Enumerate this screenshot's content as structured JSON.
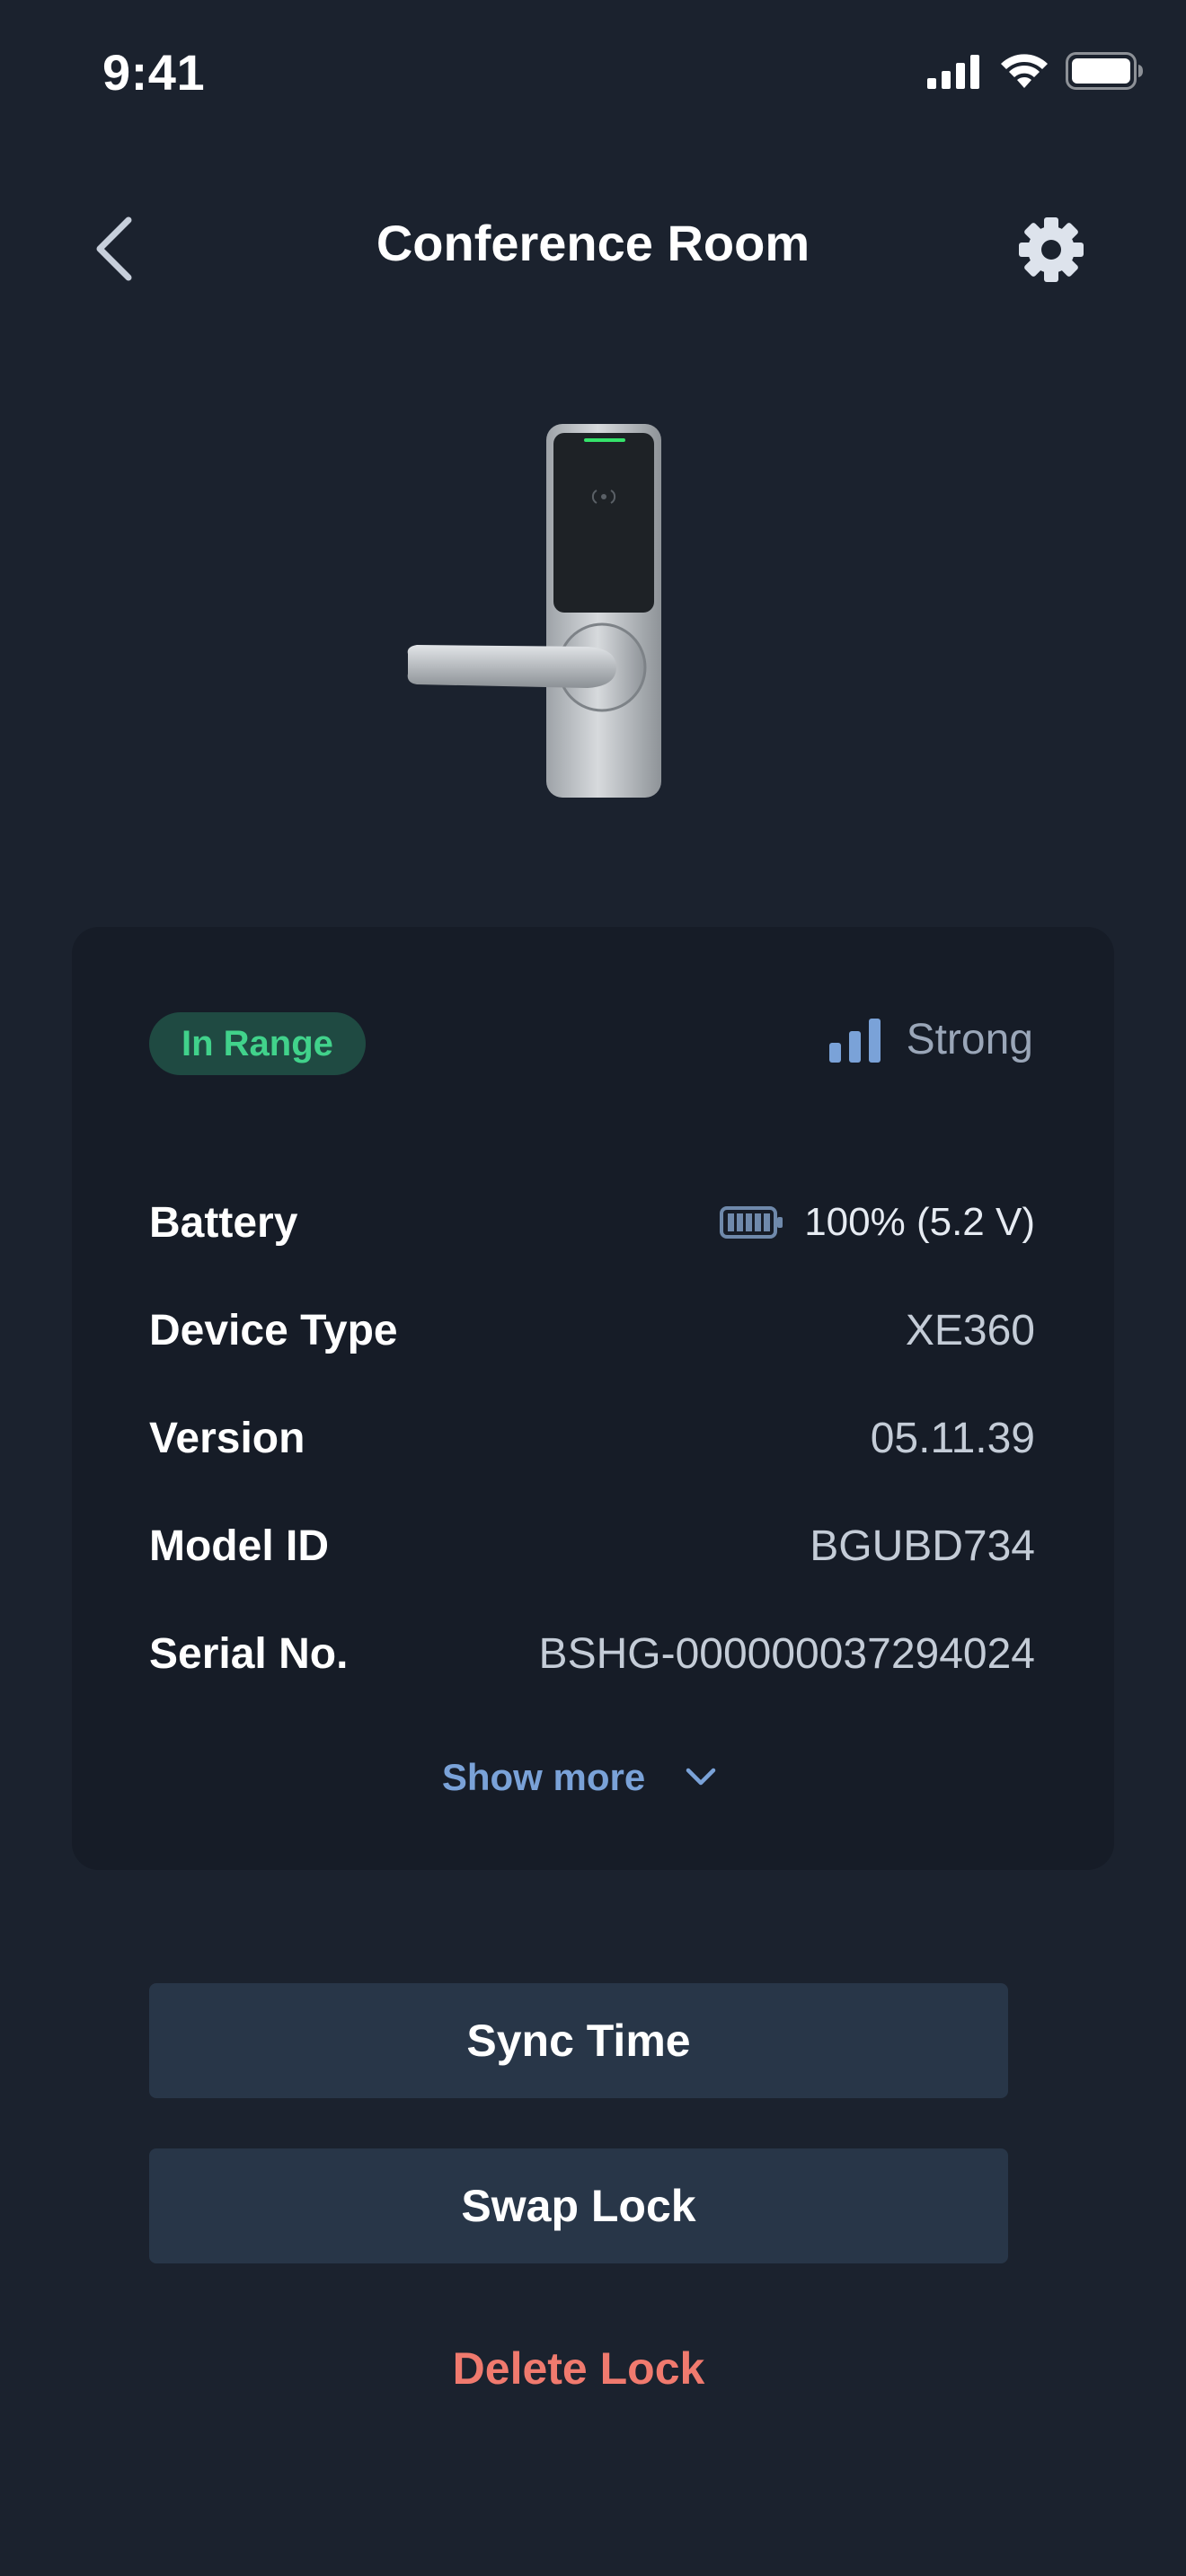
{
  "status_bar": {
    "time": "9:41"
  },
  "header": {
    "title": "Conference Room"
  },
  "card": {
    "range_badge": "In Range",
    "signal_label": "Strong",
    "rows": [
      {
        "label": "Battery",
        "value": "100% (5.2 V)"
      },
      {
        "label": "Device Type",
        "value": "XE360"
      },
      {
        "label": "Version",
        "value": "05.11.39"
      },
      {
        "label": "Model ID",
        "value": "BGUBD734"
      },
      {
        "label": "Serial No.",
        "value": "BSHG-000000037294024"
      }
    ],
    "show_more": "Show more"
  },
  "actions": {
    "sync_time": "Sync Time",
    "swap_lock": "Swap Lock",
    "delete_lock": "Delete Lock"
  },
  "colors": {
    "background": "#1b222e",
    "card": "#161c27",
    "badge_bg": "#1f4a42",
    "badge_text": "#41d28b",
    "accent_blue": "#7aa2d8",
    "delete_red": "#f07a6e"
  },
  "icons": [
    "back-chevron-icon",
    "gear-icon",
    "cellular-signal-icon",
    "wifi-icon",
    "battery-icon",
    "signal-strength-icon",
    "chevron-down-icon"
  ]
}
